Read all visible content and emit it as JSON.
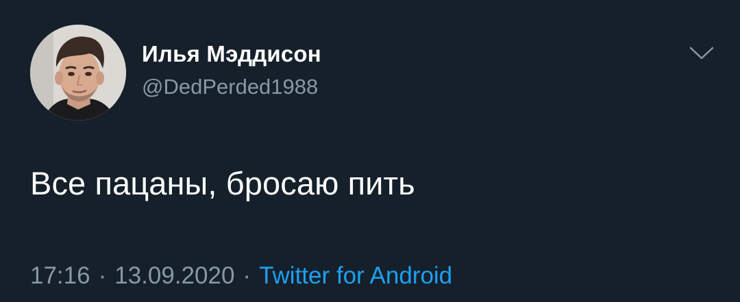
{
  "tweet": {
    "author": {
      "display_name": "Илья Мэддисон",
      "handle": "@DedPerded1988",
      "avatar": "user-avatar-photo"
    },
    "menu_icon": "chevron-down-icon",
    "text": "Все пацаны, бросаю пить",
    "meta": {
      "time": "17:16",
      "separator": "·",
      "date": "13.09.2020",
      "source": "Twitter for Android"
    },
    "colors": {
      "background": "#15202b",
      "primary_text": "#ffffff",
      "secondary_text": "#8899a6",
      "link": "#1da1f2"
    }
  }
}
